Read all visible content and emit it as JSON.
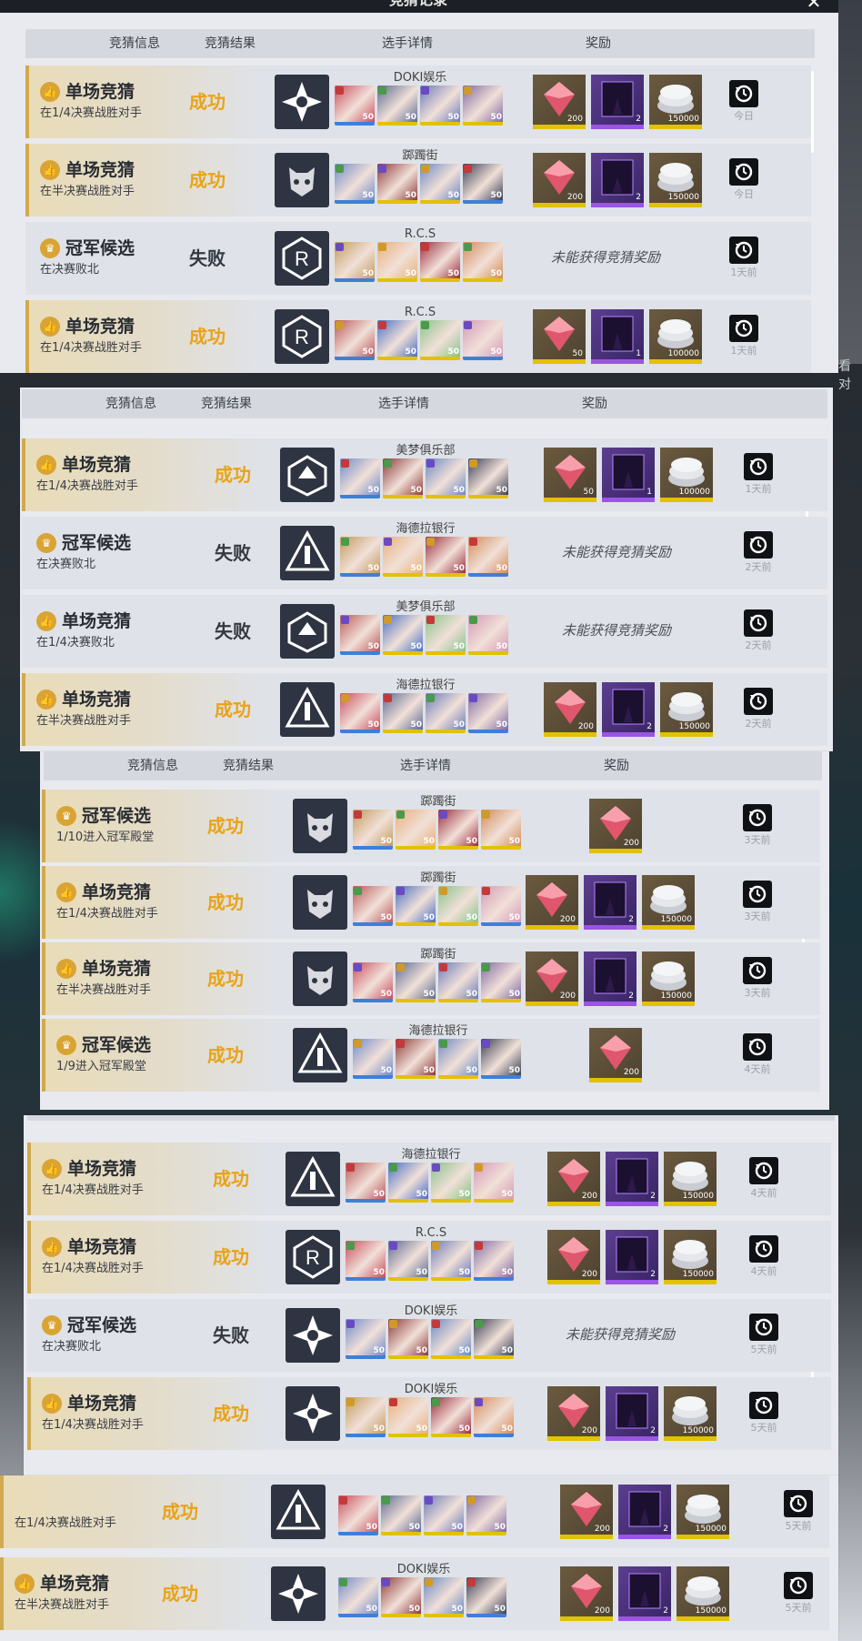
{
  "window": {
    "title": "竞猜记录",
    "watch_hint": "看对"
  },
  "header": {
    "info": "竞猜信息",
    "result": "竞猜结果",
    "players": "选手详情",
    "reward": "奖励"
  },
  "no_reward_text": "未能获得竞猜奖励",
  "panels": [
    {
      "rows": [
        {
          "kind": "单场竞猜",
          "desc": "在1/4决赛战胜对手",
          "result": "成功",
          "team": "DOKI娱乐",
          "rewards": [
            "200",
            "2",
            "150000"
          ],
          "when": "今日"
        },
        {
          "kind": "单场竞猜",
          "desc": "在半决赛战胜对手",
          "result": "成功",
          "team": "踯躅街",
          "rewards": [
            "200",
            "2",
            "150000"
          ],
          "when": "今日"
        },
        {
          "kind": "冠军候选",
          "desc": "在决赛败北",
          "result": "失败",
          "team": "R.C.S",
          "rewards": [],
          "when": "1天前"
        },
        {
          "kind": "单场竞猜",
          "desc": "在1/4决赛战胜对手",
          "result": "成功",
          "team": "R.C.S",
          "rewards": [
            "50",
            "1",
            "100000"
          ],
          "when": "1天前"
        }
      ]
    },
    {
      "rows": [
        {
          "kind": "单场竞猜",
          "desc": "在1/4决赛战胜对手",
          "result": "成功",
          "team": "美梦俱乐部",
          "rewards": [
            "50",
            "1",
            "100000"
          ],
          "when": "1天前"
        },
        {
          "kind": "冠军候选",
          "desc": "在决赛败北",
          "result": "失败",
          "team": "海德拉银行",
          "rewards": [],
          "when": "2天前"
        },
        {
          "kind": "单场竞猜",
          "desc": "在1/4决赛败北",
          "result": "失败",
          "team": "美梦俱乐部",
          "rewards": [],
          "when": "2天前"
        },
        {
          "kind": "单场竞猜",
          "desc": "在半决赛战胜对手",
          "result": "成功",
          "team": "海德拉银行",
          "rewards": [
            "200",
            "2",
            "150000"
          ],
          "when": "2天前"
        }
      ]
    },
    {
      "rows": [
        {
          "kind": "冠军候选",
          "desc": "1/10进入冠军殿堂",
          "result": "成功",
          "team": "踯躅街",
          "rewards": [
            "200"
          ],
          "when": "3天前"
        },
        {
          "kind": "单场竞猜",
          "desc": "在1/4决赛战胜对手",
          "result": "成功",
          "team": "踯躅街",
          "rewards": [
            "200",
            "2",
            "150000"
          ],
          "when": "3天前"
        },
        {
          "kind": "单场竞猜",
          "desc": "在半决赛战胜对手",
          "result": "成功",
          "team": "踯躅街",
          "rewards": [
            "200",
            "2",
            "150000"
          ],
          "when": "3天前"
        },
        {
          "kind": "冠军候选",
          "desc": "1/9进入冠军殿堂",
          "result": "成功",
          "team": "海德拉银行",
          "rewards": [
            "200"
          ],
          "when": "4天前"
        }
      ]
    },
    {
      "rows": [
        {
          "kind": "单场竞猜",
          "desc": "在1/4决赛战胜对手",
          "result": "成功",
          "team": "海德拉银行",
          "rewards": [
            "200",
            "2",
            "150000"
          ],
          "when": "4天前"
        },
        {
          "kind": "单场竞猜",
          "desc": "在1/4决赛战胜对手",
          "result": "成功",
          "team": "R.C.S",
          "rewards": [
            "200",
            "2",
            "150000"
          ],
          "when": "4天前"
        },
        {
          "kind": "冠军候选",
          "desc": "在决赛败北",
          "result": "失败",
          "team": "DOKI娱乐",
          "rewards": [],
          "when": "5天前"
        },
        {
          "kind": "单场竞猜",
          "desc": "在1/4决赛战胜对手",
          "result": "成功",
          "team": "DOKI娱乐",
          "rewards": [
            "200",
            "2",
            "150000"
          ],
          "when": "5天前"
        }
      ]
    },
    {
      "rows": [
        {
          "kind": "",
          "desc": "在1/4决赛战胜对手",
          "result": "成功",
          "team": "",
          "rewards": [
            "200",
            "2",
            "150000"
          ],
          "when": "5天前"
        },
        {
          "kind": "单场竞猜",
          "desc": "在半决赛战胜对手",
          "result": "成功",
          "team": "DOKI娱乐",
          "rewards": [
            "200",
            "2",
            "150000"
          ],
          "when": "5天前"
        }
      ]
    }
  ],
  "colors": {
    "success": "#e8a318",
    "fail": "#343840",
    "accent_gold": "#d1a94e"
  }
}
